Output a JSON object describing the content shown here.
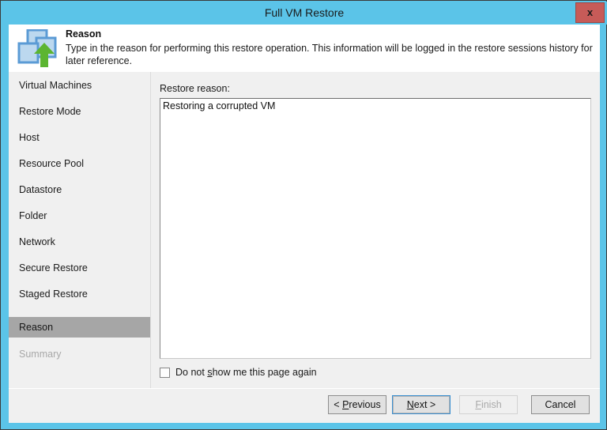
{
  "window": {
    "title": "Full VM Restore",
    "close_label": "x",
    "frame_color": "#5bc4e8",
    "close_color": "#c75b58"
  },
  "header": {
    "icon": "vm-restore-icon",
    "title": "Reason",
    "description": "Type in the reason for performing this restore operation. This information will be logged in the restore sessions history for later reference."
  },
  "sidebar": {
    "items": [
      {
        "label": "Virtual Machines",
        "state": "normal"
      },
      {
        "label": "Restore Mode",
        "state": "normal"
      },
      {
        "label": "Host",
        "state": "normal"
      },
      {
        "label": "Resource Pool",
        "state": "normal"
      },
      {
        "label": "Datastore",
        "state": "normal"
      },
      {
        "label": "Folder",
        "state": "normal"
      },
      {
        "label": "Network",
        "state": "normal"
      },
      {
        "label": "Secure Restore",
        "state": "normal"
      },
      {
        "label": "Staged Restore",
        "state": "normal"
      },
      {
        "label": "Reason",
        "state": "selected"
      },
      {
        "label": "Summary",
        "state": "disabled"
      }
    ],
    "selected_color": "#a6a6a6"
  },
  "content": {
    "reason_label": "Restore reason:",
    "reason_value": "Restoring a corrupted VM",
    "reason_placeholder": "",
    "dont_show": {
      "checked": false,
      "label_before": "Do not ",
      "label_accel": "s",
      "label_after": "how me this page again"
    }
  },
  "footer": {
    "buttons": [
      {
        "id": "previous",
        "before": "< ",
        "accel": "P",
        "after": "revious",
        "state": "normal"
      },
      {
        "id": "next",
        "before": "",
        "accel": "N",
        "after": "ext >",
        "state": "focused"
      },
      {
        "id": "finish",
        "before": "",
        "accel": "F",
        "after": "inish",
        "state": "disabled"
      },
      {
        "id": "cancel",
        "before": "",
        "accel": "",
        "after": "Cancel",
        "state": "normal"
      }
    ]
  }
}
